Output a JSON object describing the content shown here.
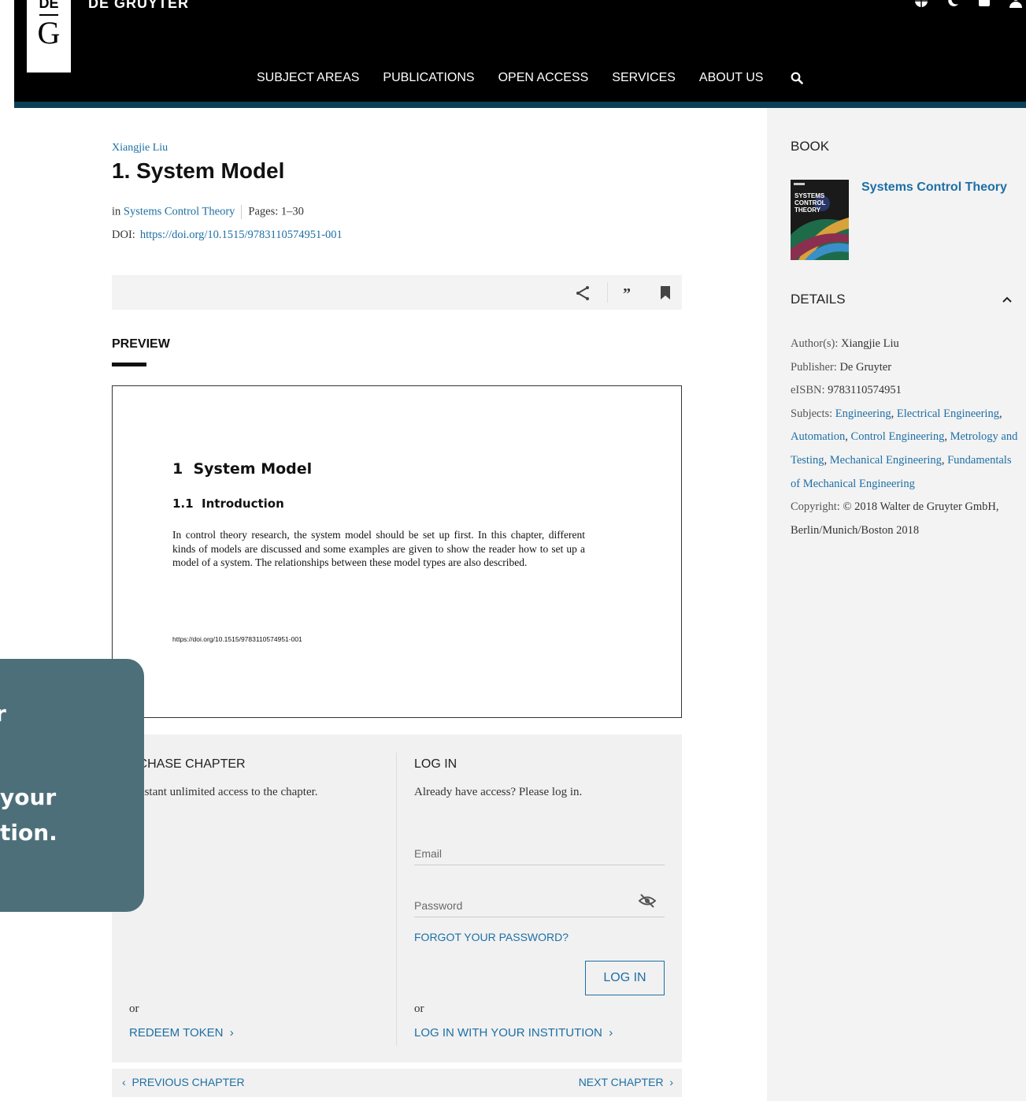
{
  "header": {
    "brand": "DE GRUYTER",
    "logo_top": "DE",
    "logo_letter": "G",
    "nav": [
      "SUBJECT AREAS",
      "PUBLICATIONS",
      "OPEN ACCESS",
      "SERVICES",
      "ABOUT US"
    ],
    "accent_color": "#0b3f55"
  },
  "chapter": {
    "author": "Xiangjie Liu",
    "title": "1. System Model",
    "in_label": "in",
    "book_link": "Systems Control Theory",
    "pages_label": "Pages:",
    "pages": "1–30",
    "doi_label": "DOI:",
    "doi": "https://doi.org/10.1515/9783110574951-001"
  },
  "toolbar": {
    "icons": [
      "share-icon",
      "cite-icon",
      "bookmark-icon"
    ],
    "cite_glyph": "”"
  },
  "preview": {
    "heading": "PREVIEW",
    "h1": "1  System Model",
    "h2": "1.1  Introduction",
    "body": "In control theory research, the system model should be set up first. In this chapter, different kinds of models are discussed and some examples are given to show the reader how to set up a model of a system. The relationships between these model types are also described.",
    "doi": "https://doi.org/10.1515/9783110574951-001"
  },
  "purchase": {
    "heading": "RCHASE CHAPTER",
    "text": "t instant unlimited access to the chapter.",
    "or": "or",
    "redeem": "REDEEM TOKEN  ›"
  },
  "login": {
    "heading": "LOG IN",
    "text": "Already have access? Please log in.",
    "email_placeholder": "Email",
    "password_placeholder": "Password",
    "forgot": "FORGOT YOUR PASSWORD?",
    "button": "LOG IN",
    "or": "or",
    "institution": "LOG IN WITH YOUR INSTITUTION  ›"
  },
  "chapter_nav": {
    "previous": "‹  PREVIOUS CHAPTER",
    "next": "NEXT CHAPTER  ›"
  },
  "sidebar": {
    "book_heading": "BOOK",
    "book_title": "Systems Control Theory",
    "cover_text": "SYSTEMS\nCONTROL\nTHEORY",
    "details_heading": "DETAILS",
    "authors_label": "Author(s):",
    "authors": "Xiangjie Liu",
    "publisher_label": "Publisher:",
    "publisher": "De Gruyter",
    "eisbn_label": "eISBN:",
    "eisbn": "9783110574951",
    "subjects_label": "Subjects:",
    "subjects": [
      "Engineering",
      "Electrical Engineering",
      "Automation",
      "Control Engineering",
      "Metrology and Testing",
      "Mechanical Engineering",
      "Fundamentals of Mechanical Engineering"
    ],
    "copyright_label": "Copyright:",
    "copyright": "© 2018 Walter de Gruyter GmbH, Berlin/Munich/Boston 2018"
  },
  "overlay": {
    "line1": "r",
    "line2": "your",
    "line3": "tion.",
    "color": "#4d6f7a"
  }
}
